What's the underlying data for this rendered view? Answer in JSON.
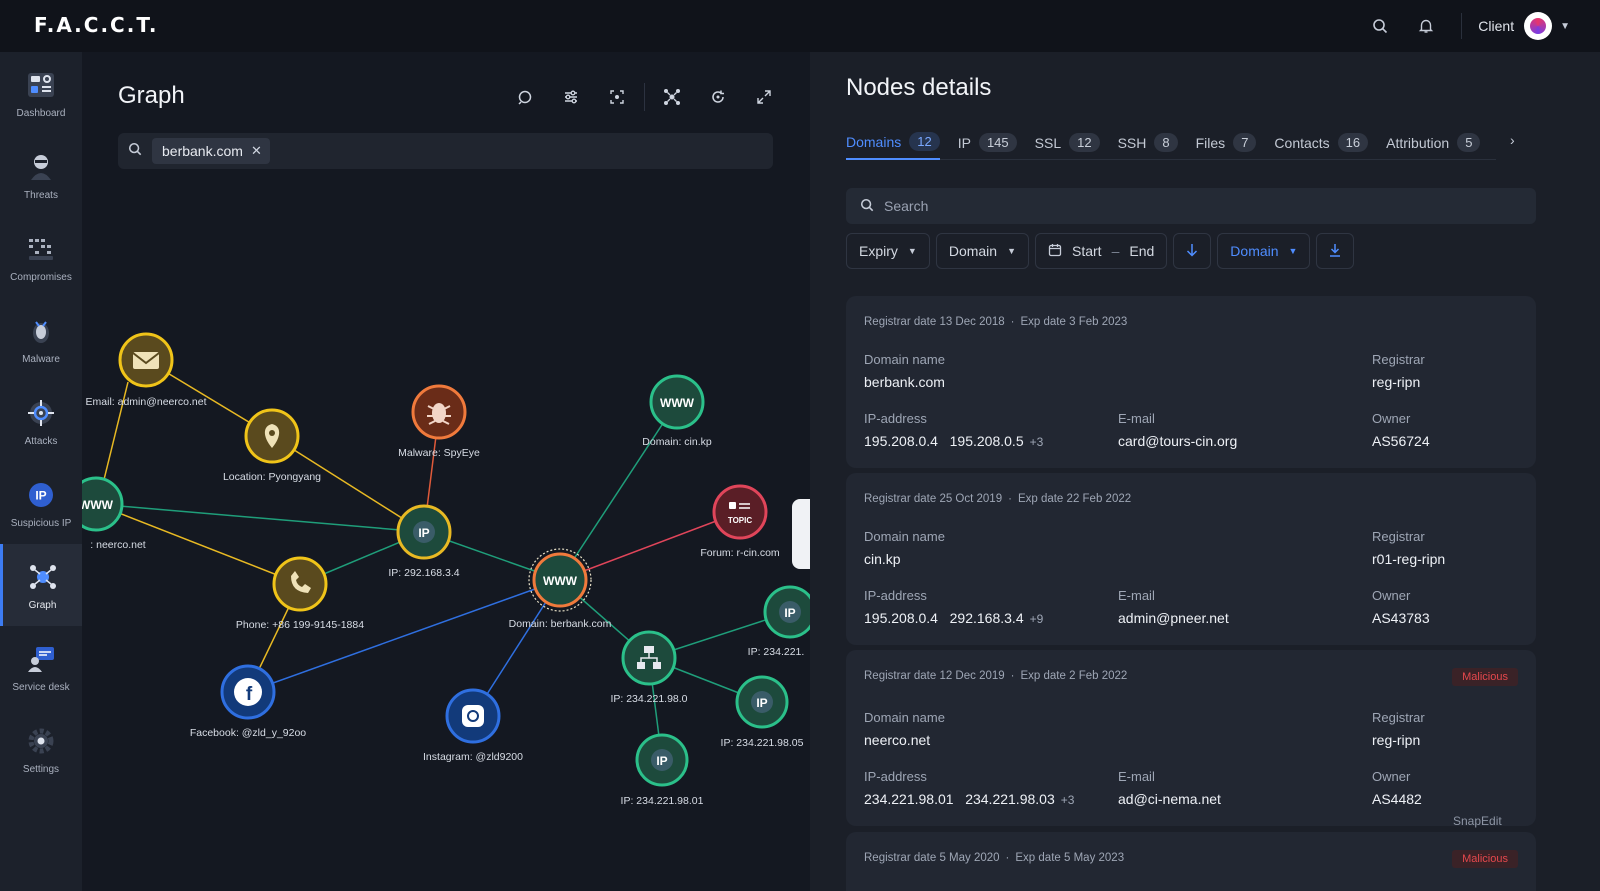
{
  "topbar": {
    "logo": "F.A.C.C.T.",
    "client_label": "Client"
  },
  "sidebar": {
    "items": [
      {
        "label": "Dashboard",
        "icon": "dashboard-icon"
      },
      {
        "label": "Threats",
        "icon": "threat-actor-icon"
      },
      {
        "label": "Compromises",
        "icon": "compromises-icon"
      },
      {
        "label": "Malware",
        "icon": "malware-icon"
      },
      {
        "label": "Attacks",
        "icon": "attacks-icon"
      },
      {
        "label": "Suspicious IP",
        "icon": "ip-icon"
      },
      {
        "label": "Graph",
        "icon": "graph-icon",
        "active": true
      },
      {
        "label": "Service desk",
        "icon": "service-desk-icon"
      },
      {
        "label": "Settings",
        "icon": "settings-icon"
      }
    ]
  },
  "graph": {
    "title": "Graph",
    "search_chip": "berbank.com",
    "nodes": {
      "email": "Email: admin@neerco.net",
      "location": "Location: Pyongyang",
      "malware": "Malware: SpyEye",
      "cinkp": "Domain: cin.kp",
      "neerco": ": neerco.net",
      "ip_main": "IP: 292.168.3.4",
      "forum": "Forum: r-cin.com",
      "topic": "TOPIC",
      "phone": "Phone: +86 199-9145-1884",
      "berbank": "Domain: berbank.com",
      "ip_right": "IP: 234.221.",
      "facebook": "Facebook: @zld_y_92oo",
      "instagram": "Instagram: @zld9200",
      "ip_center": "IP: 234.221.98.0",
      "ip_05": "IP: 234.221.98.05",
      "ip_01": "IP: 234.221.98.01",
      "www": "WWW",
      "ip": "IP"
    }
  },
  "details": {
    "title": "Nodes details",
    "tabs": [
      {
        "label": "Domains",
        "count": "12",
        "active": true
      },
      {
        "label": "IP",
        "count": "145"
      },
      {
        "label": "SSL",
        "count": "12"
      },
      {
        "label": "SSH",
        "count": "8"
      },
      {
        "label": "Files",
        "count": "7"
      },
      {
        "label": "Contacts",
        "count": "16"
      },
      {
        "label": "Attribution",
        "count": "5"
      }
    ],
    "search_placeholder": "Search",
    "filters": {
      "expiry": "Expiry",
      "domain": "Domain",
      "start": "Start",
      "end": "End",
      "sort_domain": "Domain"
    },
    "labels": {
      "domain_name": "Domain name",
      "registrar": "Registrar",
      "ip_address": "IP-address",
      "email": "E-mail",
      "owner": "Owner",
      "registrar_date": "Registrar date",
      "exp_date": "Exp date"
    },
    "cards": [
      {
        "reg_date": "13 Dec 2018",
        "exp_date": "3 Feb 2023",
        "domain": "berbank.com",
        "registrar": "reg-ripn",
        "ip1": "195.208.0.4",
        "ip2": "195.208.0.5",
        "ip_more": "+3",
        "email": "card@tours-cin.org",
        "owner": "AS56724",
        "badge": ""
      },
      {
        "reg_date": "25 Oct 2019",
        "exp_date": "22 Feb 2022",
        "domain": "cin.kp",
        "registrar": "r01-reg-ripn",
        "ip1": "195.208.0.4",
        "ip2": "292.168.3.4",
        "ip_more": "+9",
        "email": "admin@pneer.net",
        "owner": "AS43783",
        "badge": ""
      },
      {
        "reg_date": "12 Dec 2019",
        "exp_date": "2 Feb 2022",
        "domain": "neerco.net",
        "registrar": "reg-ripn",
        "ip1": "234.221.98.01",
        "ip2": "234.221.98.03",
        "ip_more": "+3",
        "email": "ad@ci-nema.net",
        "owner": "AS4482",
        "badge": "Malicious"
      },
      {
        "reg_date": "5 May 2020",
        "exp_date": "5 May 2023",
        "badge": "Malicious"
      }
    ],
    "watermark": "SnapEdit"
  },
  "colors": {
    "accent": "#4f8dff",
    "malicious": "#e5484d",
    "edge_yellow": "#e8b923",
    "edge_teal": "#1f9e7a",
    "edge_blue": "#2f6fe0",
    "edge_red": "#e0455a"
  }
}
